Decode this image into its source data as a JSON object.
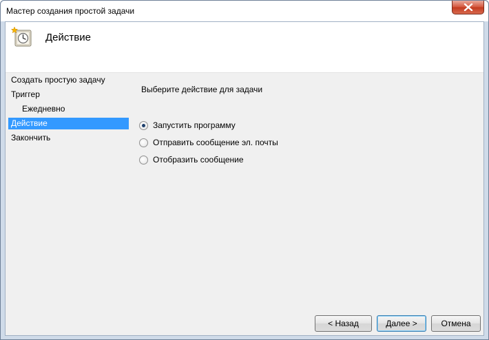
{
  "window": {
    "title": "Мастер создания простой задачи"
  },
  "header": {
    "title": "Действие",
    "icon": "task-scheduler-icon"
  },
  "steps": [
    {
      "label": "Создать простую задачу"
    },
    {
      "label": "Триггер"
    },
    {
      "label": "Ежедневно"
    },
    {
      "label": "Действие"
    },
    {
      "label": "Закончить"
    }
  ],
  "main": {
    "prompt": "Выберите действие для задачи",
    "options": [
      {
        "label": "Запустить программу",
        "checked": true
      },
      {
        "label": "Отправить сообщение эл. почты",
        "checked": false
      },
      {
        "label": "Отобразить сообщение",
        "checked": false
      }
    ]
  },
  "buttons": {
    "back": "< Назад",
    "next": "Далее >",
    "cancel": "Отмена"
  },
  "colors": {
    "selection": "#3399ff",
    "close": "#c23a1f"
  }
}
